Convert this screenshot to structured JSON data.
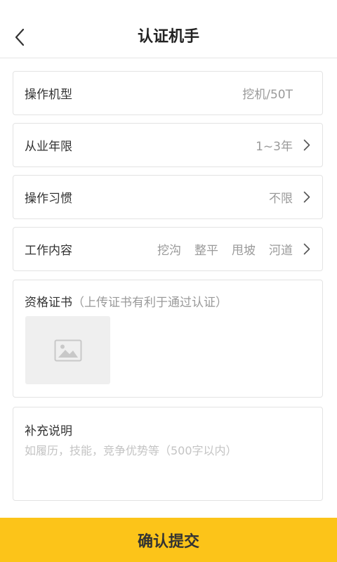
{
  "header": {
    "title": "认证机手"
  },
  "rows": [
    {
      "label": "操作机型",
      "value": "挖机/50T"
    },
    {
      "label": "从业年限",
      "value": "1~3年"
    },
    {
      "label": "操作习惯",
      "value": "不限"
    },
    {
      "label": "工作内容",
      "tags": [
        "挖沟",
        "整平",
        "甩坡",
        "河道"
      ]
    }
  ],
  "certificate": {
    "title": "资格证书",
    "hint": "（上传证书有利于通过认证）"
  },
  "notes": {
    "title": "补充说明",
    "placeholder": "如履历，技能，竞争优势等（500字以内）"
  },
  "submit": {
    "label": "确认提交"
  },
  "colors": {
    "accent": "#fcc419",
    "border": "#e3e3e3",
    "muted": "#9a9a9a"
  },
  "icons": {
    "back": "chevron-left-icon",
    "row_arrow": "chevron-right-icon",
    "upload": "image-icon"
  }
}
